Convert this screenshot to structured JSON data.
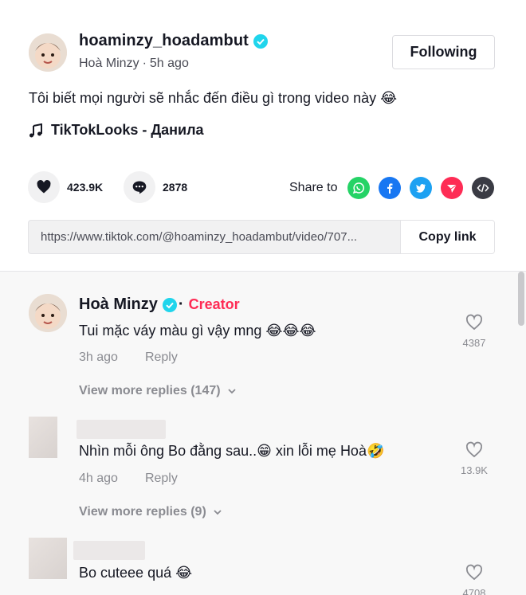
{
  "post": {
    "username": "hoaminzy_hoadambut",
    "display_name": "Hoà Minzy",
    "time_ago": "5h ago",
    "follow_label": "Following",
    "caption": "Tôi biết mọi người sẽ nhắc đến điều gì trong video này 😂",
    "music": "TikTokLooks - Данила",
    "likes": "423.9K",
    "comments": "2878",
    "share_label": "Share to",
    "share_icons": [
      "whatsapp-icon",
      "facebook-icon",
      "twitter-icon",
      "send-icon",
      "embed-icon"
    ],
    "link_url": "https://www.tiktok.com/@hoaminzy_hoadambut/video/707...",
    "copy_link_label": "Copy link"
  },
  "colors": {
    "creator": "#fe2c55",
    "verified": "#20d5ec",
    "whatsapp": "#25d366",
    "facebook": "#1877f2",
    "twitter": "#1da1f2",
    "send": "#fe2c55",
    "embed": "#3a3b44"
  },
  "comments": [
    {
      "name": "Hoà Minzy",
      "badge": "Creator",
      "text": "Tui mặc váy màu gì vậy mng 😂😂😂",
      "time": "3h ago",
      "reply_label": "Reply",
      "likes": "4387",
      "view_more": "View more replies (147)"
    },
    {
      "name": "",
      "text": "Nhìn mỗi ông Bo đằng sau..😁 xin lỗi mẹ Hoà🤣",
      "time": "4h ago",
      "reply_label": "Reply",
      "likes": "13.9K",
      "view_more": "View more replies (9)"
    },
    {
      "name": "",
      "text": "Bo cuteee quá 😂",
      "time": "",
      "reply_label": "",
      "likes": "4708"
    }
  ]
}
